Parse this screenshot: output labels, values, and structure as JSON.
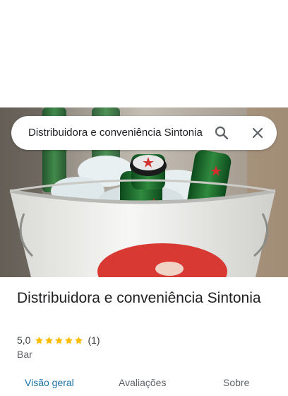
{
  "search": {
    "value": "Distribuidora e conveniência Sintonia"
  },
  "place": {
    "title": "Distribuidora e conveniência Sintonia",
    "rating": "5,0",
    "stars": 5,
    "review_count": "(1)",
    "category": "Bar"
  },
  "tabs": [
    {
      "label": "Visão geral",
      "active": true
    },
    {
      "label": "Avaliações",
      "active": false
    },
    {
      "label": "Sobre",
      "active": false
    }
  ],
  "colors": {
    "star": "#fbbc04",
    "accent": "#1a73a8"
  },
  "icons": {
    "search": "search-icon",
    "close": "close-icon",
    "star": "star-icon"
  }
}
